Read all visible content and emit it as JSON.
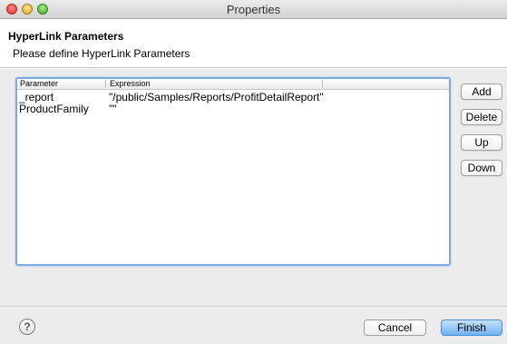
{
  "window": {
    "title": "Properties"
  },
  "header": {
    "title": "HyperLink Parameters",
    "description": "Please define HyperLink Parameters"
  },
  "table": {
    "columns": [
      "Parameter",
      "Expression"
    ],
    "rows": [
      {
        "parameter": "_report",
        "expression": "\"/public/Samples/Reports/ProfitDetailReport\""
      },
      {
        "parameter": "ProductFamily",
        "expression": "\"\""
      }
    ]
  },
  "side_buttons": {
    "add": "Add",
    "delete": "Delete",
    "up": "Up",
    "down": "Down"
  },
  "footer": {
    "help_glyph": "?",
    "cancel": "Cancel",
    "finish": "Finish"
  },
  "colors": {
    "focus_ring": "#7fa9e0",
    "default_button": "#6fb1f2"
  }
}
